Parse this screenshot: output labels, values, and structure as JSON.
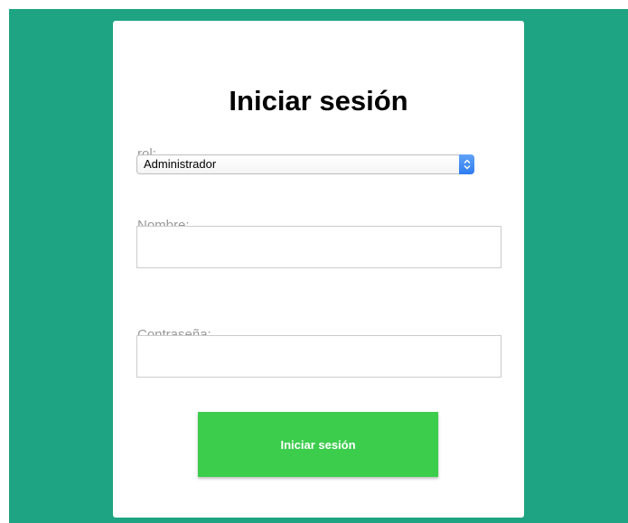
{
  "login": {
    "title": "Iniciar sesión",
    "role_label": "rol:",
    "role_selected": "Administrador",
    "name_label": "Nombre:",
    "name_value": "",
    "password_label": "Contraseña:",
    "password_value": "",
    "submit_label": "Iniciar sesión"
  },
  "colors": {
    "background": "#1ea482",
    "card": "#ffffff",
    "button": "#3ccd4d",
    "select_arrow": "#2f7cf0",
    "label": "#999999"
  },
  "icons": {
    "select_arrow": "chevron-up-down-icon"
  }
}
